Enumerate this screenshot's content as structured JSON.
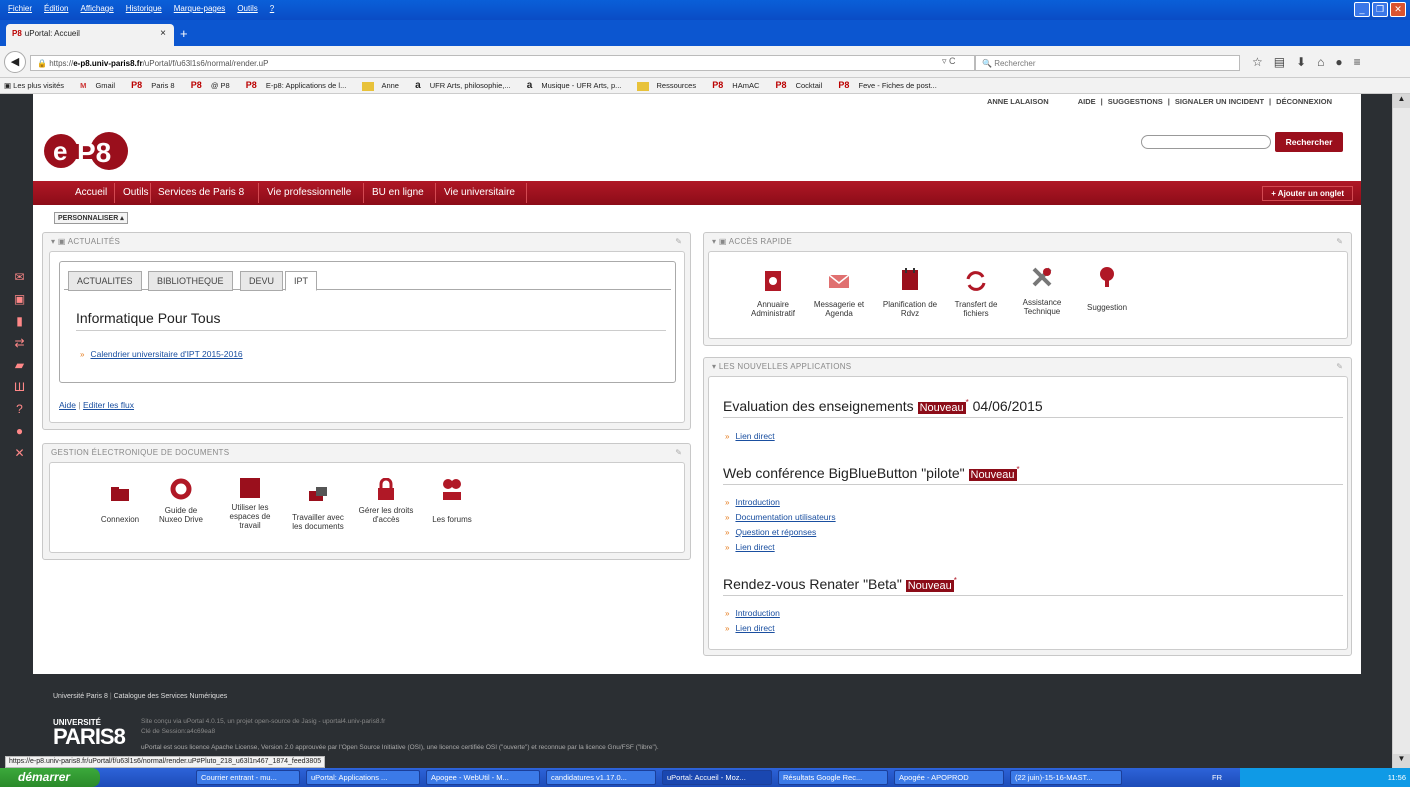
{
  "menubar": {
    "items": [
      "Fichier",
      "Édition",
      "Affichage",
      "Historique",
      "Marque-pages",
      "Outils",
      "?"
    ]
  },
  "browser": {
    "tab_title": "uPortal: Accueil",
    "tab_icon": "P8",
    "url_host": "e-p8.univ-paris8.fr",
    "url_prefix": "https://",
    "url_path": "/uPortal/f/u63l1s6/normal/render.uP",
    "search_placeholder": "Rechercher"
  },
  "bookmarks": [
    {
      "label": "Les plus visités",
      "icon": "globe-icon"
    },
    {
      "label": "Gmail",
      "icon": "M"
    },
    {
      "label": "Paris 8",
      "icon": "P8"
    },
    {
      "label": "@ P8",
      "icon": "P8"
    },
    {
      "label": "E-p8: Applications de l...",
      "icon": "P8"
    },
    {
      "label": "Anne",
      "icon": "folder"
    },
    {
      "label": "UFR Arts, philosophie,...",
      "icon": "a"
    },
    {
      "label": "Musique - UFR Arts, p...",
      "icon": "a"
    },
    {
      "label": "Ressources",
      "icon": "folder"
    },
    {
      "label": "HAmAC",
      "icon": "P8"
    },
    {
      "label": "Cocktail",
      "icon": "P8"
    },
    {
      "label": "Feve - Fiches de post...",
      "icon": "P8"
    }
  ],
  "header": {
    "user": "ANNE LALAISON",
    "links": [
      "AIDE",
      "SUGGESTIONS",
      "SIGNALER UN INCIDENT",
      "DÉCONNEXION"
    ],
    "search_button": "Rechercher",
    "logo": "e-P8"
  },
  "nav": {
    "items": [
      "Accueil",
      "Outils",
      "Services de Paris 8",
      "Vie professionnelle",
      "BU en ligne",
      "Vie universitaire"
    ],
    "add_tab": "+ Ajouter un onglet",
    "personalize": "PERSONNALISER"
  },
  "actualites": {
    "title": "ACTUALITÉS",
    "tabs": [
      "ACTUALITES",
      "BIBLIOTHEQUE",
      "DEVU",
      "IPT"
    ],
    "active_tab": "IPT",
    "heading": "Informatique Pour Tous",
    "link": "Calendrier universitaire d'IPT 2015-2016",
    "footer_links": [
      "Aide",
      "Editer les flux"
    ]
  },
  "ged": {
    "title": "GESTION ÉLECTRONIQUE DE DOCUMENTS",
    "apps": [
      {
        "label": "Connexion",
        "icon": "folder-icon"
      },
      {
        "label": "Guide de Nuxeo Drive",
        "icon": "sync-icon"
      },
      {
        "label": "Utiliser les espaces de travail",
        "icon": "workspace-icon"
      },
      {
        "label": "Travailler avec les documents",
        "icon": "documents-icon"
      },
      {
        "label": "Gérer les droits d'accès",
        "icon": "lock-icon"
      },
      {
        "label": "Les forums",
        "icon": "forum-icon"
      }
    ]
  },
  "acces_rapide": {
    "title": "ACCÈS RAPIDE",
    "apps": [
      {
        "label": "Annuaire Administratif",
        "icon": "directory-icon"
      },
      {
        "label": "Messagerie et Agenda",
        "icon": "mail-icon"
      },
      {
        "label": "Planification de Rdvz",
        "icon": "calendar-icon"
      },
      {
        "label": "Transfert de fichiers",
        "icon": "transfer-icon"
      },
      {
        "label": "Assistance Technique",
        "icon": "tools-icon"
      },
      {
        "label": "Suggestion",
        "icon": "lightbulb-icon"
      }
    ]
  },
  "nouvelles_apps": {
    "title": "LES NOUVELLES APPLICATIONS",
    "badge": "Nouveau",
    "items": [
      {
        "title": "Evaluation des enseignements",
        "date": "04/06/2015",
        "links": [
          "Lien direct"
        ]
      },
      {
        "title": "Web conférence BigBlueButton \"pilote\"",
        "date": "",
        "links": [
          "Introduction",
          "Documentation utilisateurs",
          "Question et réponses",
          "Lien direct"
        ]
      },
      {
        "title": "Rendez-vous Renater \"Beta\"",
        "date": "",
        "links": [
          "Introduction",
          "Lien direct"
        ]
      }
    ]
  },
  "footer": {
    "links": [
      "Université Paris 8",
      "Catalogue des Services Numériques"
    ],
    "line1": "Site conçu via uPortal 4.0.15, un projet open-source de Jasig - uportal4.univ-paris8.fr",
    "line2": "Clé de Session:a4c69ea8",
    "line3": "uPortal est sous licence Apache License, Version 2.0 approuvée par l'Open Source Initiative (OSI), une licence certifiée OSI (\"ouverte\") et reconnue par la licence Gnu/FSF (\"libre\").",
    "logo_top": "UNIVERSITÉ",
    "logo_bottom": "PARIS8"
  },
  "status_url": "https://e-p8.univ-paris8.fr/uPortal/f/u63l1s6/normal/render.uP#Pluto_218_u63l1n467_1874_feed3805",
  "taskbar": {
    "start": "démarrer",
    "items": [
      "Courrier entrant - mu...",
      "uPortal: Applications ...",
      "Apogee - WebUtil - M...",
      "candidatures v1.17.0...",
      "uPortal: Accueil - Moz...",
      "Résultats Google Rec...",
      "Apogée - APOPROD",
      "(22 juin)-15-16-MAST..."
    ],
    "lang": "FR",
    "time": "11:56"
  },
  "colors": {
    "brand": "#9a0f1c",
    "link": "#1a4fa0",
    "bullet": "#e67e22",
    "xp_blue": "#0c56d0"
  }
}
